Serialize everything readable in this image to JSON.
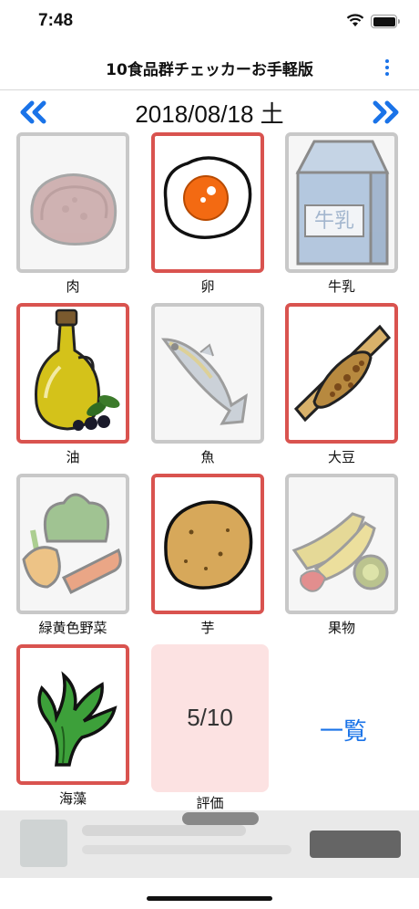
{
  "status_bar": {
    "time": "7:48"
  },
  "header": {
    "title": "10食品群チェッカーお手軽版"
  },
  "date_bar": {
    "date": "2018/08/18 土"
  },
  "foods": [
    {
      "label": "肉",
      "checked": false,
      "icon": "meat-icon"
    },
    {
      "label": "卵",
      "checked": true,
      "icon": "egg-icon"
    },
    {
      "label": "牛乳",
      "checked": false,
      "icon": "milk-icon",
      "icon_text": "牛乳"
    },
    {
      "label": "油",
      "checked": true,
      "icon": "oil-icon"
    },
    {
      "label": "魚",
      "checked": false,
      "icon": "fish-icon"
    },
    {
      "label": "大豆",
      "checked": true,
      "icon": "natto-icon"
    },
    {
      "label": "緑黄色野菜",
      "checked": false,
      "icon": "vegetables-icon"
    },
    {
      "label": "芋",
      "checked": true,
      "icon": "potato-icon"
    },
    {
      "label": "果物",
      "checked": false,
      "icon": "fruit-icon"
    },
    {
      "label": "海藻",
      "checked": true,
      "icon": "seaweed-icon"
    }
  ],
  "score": {
    "value": "5/10",
    "label": "評価"
  },
  "list_link": "一覧",
  "colors": {
    "accent": "#1a73e8",
    "checked_border": "#d9534f",
    "unchecked_border": "#c8c8c8",
    "score_bg": "#fce2e2"
  }
}
